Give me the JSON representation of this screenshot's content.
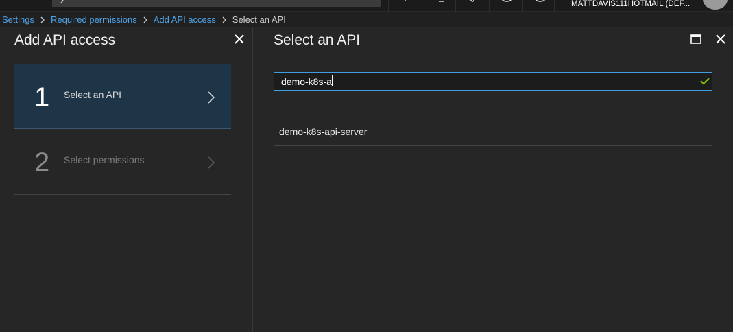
{
  "topbar": {
    "account_name": "MATTDAVIS111HOTMAIL (DEF..."
  },
  "breadcrumb": {
    "items": [
      {
        "label": "Settings"
      },
      {
        "label": "Required permissions"
      },
      {
        "label": "Add API access"
      }
    ],
    "current": "Select an API"
  },
  "left_blade": {
    "title": "Add API access",
    "steps": [
      {
        "number": "1",
        "label": "Select an API",
        "state": "active"
      },
      {
        "number": "2",
        "label": "Select permissions",
        "state": "inactive"
      }
    ]
  },
  "right_blade": {
    "title": "Select an API",
    "search": {
      "value": "demo-k8s-a",
      "valid": true
    },
    "results": [
      {
        "label": "demo-k8s-api-server"
      }
    ]
  },
  "colors": {
    "accent": "#3e9fe0",
    "link": "#4da3e8",
    "success": "#7fba00",
    "active_step_bg": "#1e3447"
  }
}
